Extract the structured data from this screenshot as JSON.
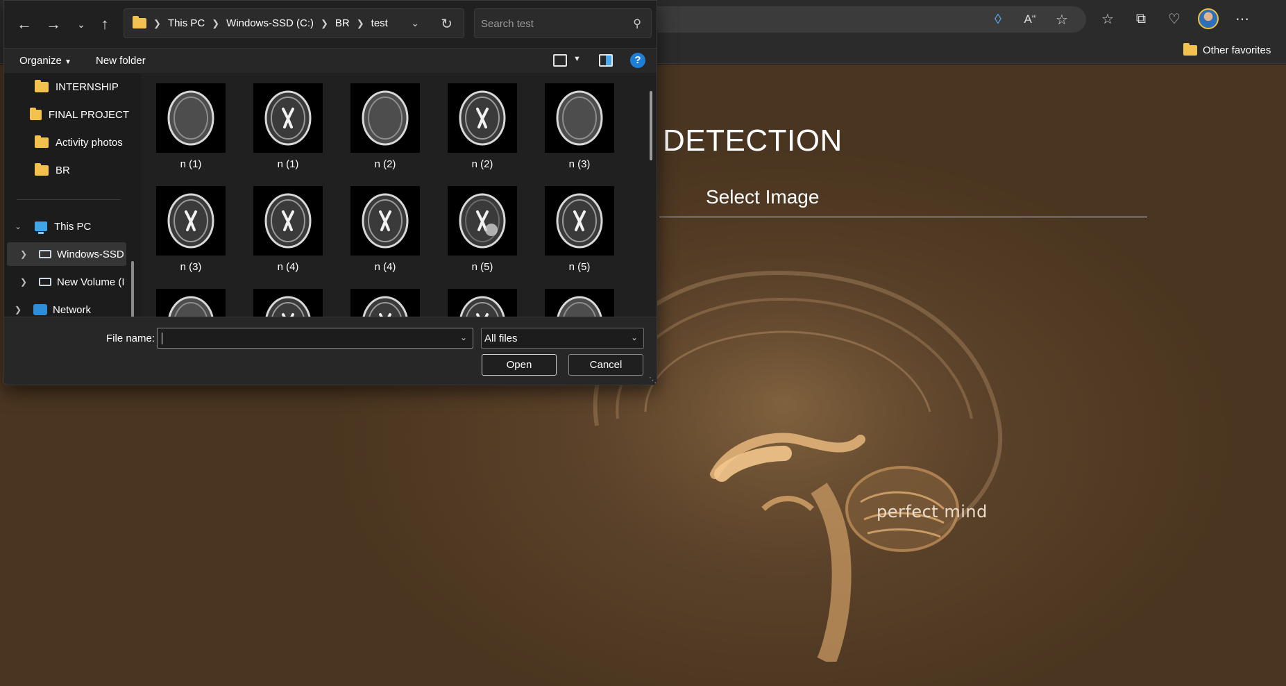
{
  "browser": {
    "favorites_bar": {
      "other_favorites_label": "Other favorites"
    },
    "toolbar_icons": [
      "tag-icon",
      "read-aloud-icon",
      "add-favorite-icon",
      "favorites-icon",
      "collections-icon",
      "browser-essentials-icon",
      "profile-avatar",
      "more-icon"
    ]
  },
  "page": {
    "heading": "DETECTION",
    "select_image_label": "Select Image",
    "brain_caption": "perfect mind"
  },
  "dialog": {
    "breadcrumb": [
      "This PC",
      "Windows-SSD (C:)",
      "BR",
      "test"
    ],
    "search_placeholder": "Search test",
    "command_bar": {
      "organize_label": "Organize",
      "new_folder_label": "New folder"
    },
    "nav_tree": [
      {
        "label": "INTERNSHIP",
        "type": "folder"
      },
      {
        "label": "FINAL PROJECT",
        "type": "folder"
      },
      {
        "label": "Activity photos",
        "type": "folder"
      },
      {
        "label": "BR",
        "type": "folder"
      },
      {
        "label": "This PC",
        "type": "pc",
        "expanded": true
      },
      {
        "label": "Windows-SSD",
        "type": "drive",
        "selected": true
      },
      {
        "label": "New Volume (I",
        "type": "drive"
      },
      {
        "label": "Network",
        "type": "network"
      }
    ],
    "files": [
      {
        "name": "n (1)",
        "style": "flair"
      },
      {
        "name": "n (1)",
        "style": "t2"
      },
      {
        "name": "n (2)",
        "style": "flair"
      },
      {
        "name": "n (2)",
        "style": "t2"
      },
      {
        "name": "n (3)",
        "style": "flair"
      },
      {
        "name": "n (3)",
        "style": "t2"
      },
      {
        "name": "n (4)",
        "style": "t2"
      },
      {
        "name": "n (4)",
        "style": "t2"
      },
      {
        "name": "n (5)",
        "style": "tumor"
      },
      {
        "name": "n (5)",
        "style": "t2"
      },
      {
        "name": "",
        "style": "flair"
      },
      {
        "name": "",
        "style": "t2"
      },
      {
        "name": "",
        "style": "t2"
      },
      {
        "name": "",
        "style": "t2"
      },
      {
        "name": "",
        "style": "flair"
      }
    ],
    "footer": {
      "file_name_label": "File name:",
      "file_name_value": "",
      "file_type": "All files",
      "open_label": "Open",
      "cancel_label": "Cancel"
    }
  }
}
